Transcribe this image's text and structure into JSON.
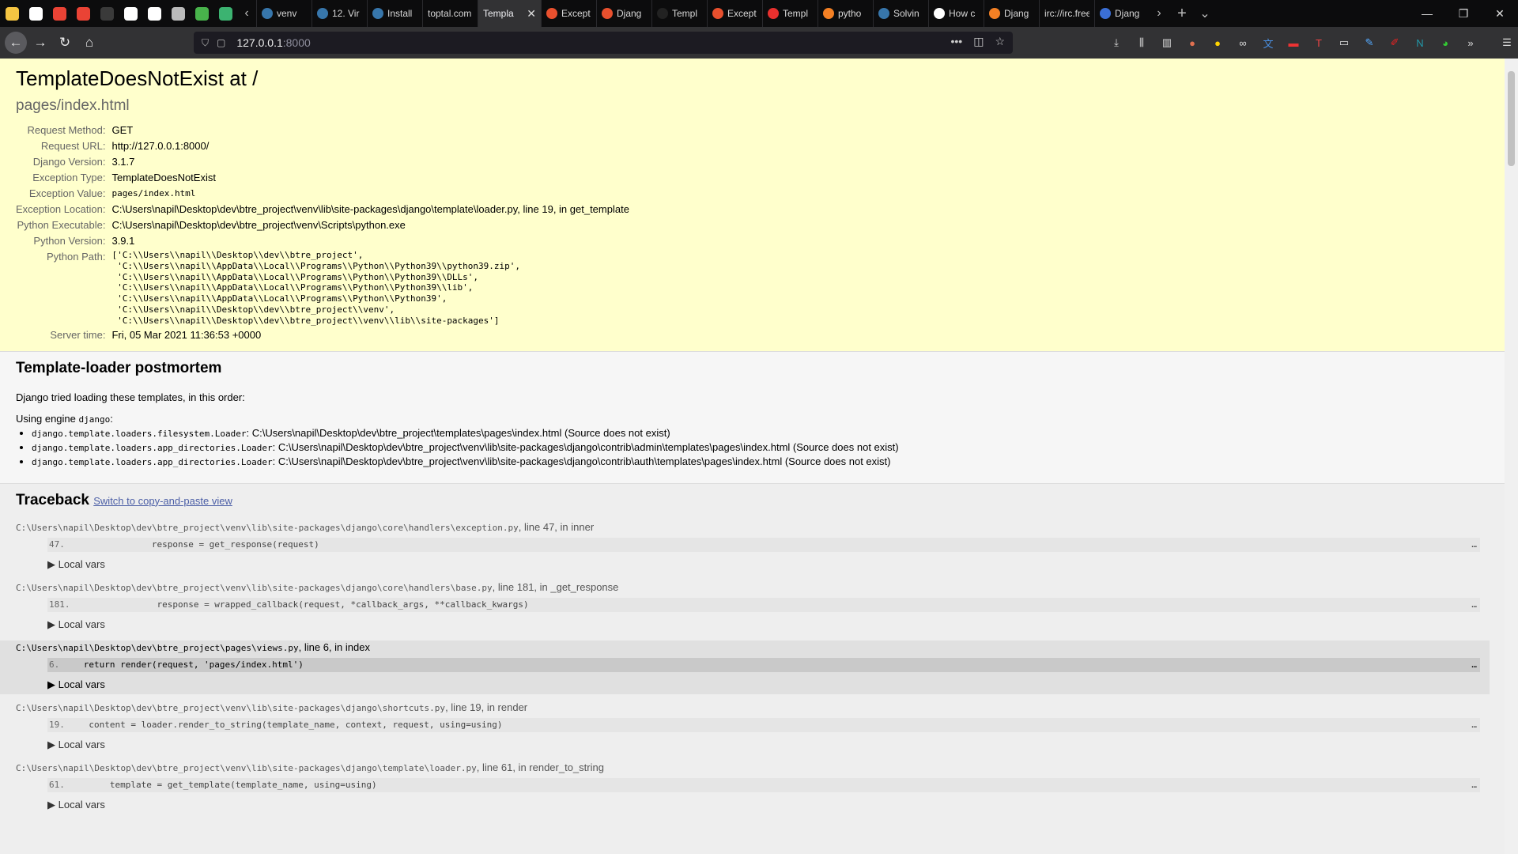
{
  "browser": {
    "pinned": [
      {
        "icon": "sticky-note-icon",
        "color": "#f5c542"
      },
      {
        "icon": "github-icon",
        "color": "#ffffff"
      },
      {
        "icon": "gmail-icon",
        "color": "#ea4335"
      },
      {
        "icon": "gmail-icon-2",
        "color": "#ea4335"
      },
      {
        "icon": "blank-icon",
        "color": "#3a3a3a"
      },
      {
        "icon": "globe-icon",
        "color": "#ffffff"
      },
      {
        "icon": "app-icon",
        "color": "#ffffff"
      },
      {
        "icon": "list-icon",
        "color": "#bbbbbb"
      },
      {
        "icon": "circle-app-icon",
        "color": "#48b34b"
      },
      {
        "icon": "note-icon",
        "color": "#3cb371"
      }
    ],
    "tabs": [
      {
        "title": "venv",
        "color": "#3776ab"
      },
      {
        "title": "12. Vir",
        "color": "#3776ab"
      },
      {
        "title": "Install",
        "color": "#3776ab"
      },
      {
        "title": "toptal.com",
        "color": ""
      },
      {
        "title": "Templa",
        "color": "",
        "active": true
      },
      {
        "title": "Except",
        "color": "#e8502e"
      },
      {
        "title": "Djang",
        "color": "#e8502e"
      },
      {
        "title": "Templ",
        "color": "#222222"
      },
      {
        "title": "Except",
        "color": "#e8502e"
      },
      {
        "title": "Templ",
        "color": "#e8302e"
      },
      {
        "title": "pytho",
        "color": "#f48024"
      },
      {
        "title": "Solvin",
        "color": "#3776ab"
      },
      {
        "title": "How c",
        "color": "#ffffff"
      },
      {
        "title": "Djang",
        "color": "#f48024"
      },
      {
        "title": "irc://irc.freen",
        "color": ""
      },
      {
        "title": "Djang",
        "color": "#3b6fd6"
      }
    ],
    "url_host": "127.0.0.1",
    "url_port": ":8000"
  },
  "summary": {
    "title": "TemplateDoesNotExist at /",
    "subtitle": "pages/index.html",
    "rows": [
      {
        "label": "Request Method:",
        "value": "GET"
      },
      {
        "label": "Request URL:",
        "value": "http://127.0.0.1:8000/"
      },
      {
        "label": "Django Version:",
        "value": "3.1.7"
      },
      {
        "label": "Exception Type:",
        "value": "TemplateDoesNotExist"
      },
      {
        "label": "Exception Value:",
        "value": "pages/index.html",
        "mono": true
      },
      {
        "label": "Exception Location:",
        "value": "C:\\Users\\napil\\Desktop\\dev\\btre_project\\venv\\lib\\site-packages\\django\\template\\loader.py, line 19, in get_template"
      },
      {
        "label": "Python Executable:",
        "value": "C:\\Users\\napil\\Desktop\\dev\\btre_project\\venv\\Scripts\\python.exe"
      },
      {
        "label": "Python Version:",
        "value": "3.9.1"
      }
    ],
    "python_path_label": "Python Path:",
    "python_path": "['C:\\\\Users\\\\napil\\\\Desktop\\\\dev\\\\btre_project',\n 'C:\\\\Users\\\\napil\\\\AppData\\\\Local\\\\Programs\\\\Python\\\\Python39\\\\python39.zip',\n 'C:\\\\Users\\\\napil\\\\AppData\\\\Local\\\\Programs\\\\Python\\\\Python39\\\\DLLs',\n 'C:\\\\Users\\\\napil\\\\AppData\\\\Local\\\\Programs\\\\Python\\\\Python39\\\\lib',\n 'C:\\\\Users\\\\napil\\\\AppData\\\\Local\\\\Programs\\\\Python\\\\Python39',\n 'C:\\\\Users\\\\napil\\\\Desktop\\\\dev\\\\btre_project\\\\venv',\n 'C:\\\\Users\\\\napil\\\\Desktop\\\\dev\\\\btre_project\\\\venv\\\\lib\\\\site-packages']",
    "server_time_label": "Server time:",
    "server_time": "Fri, 05 Mar 2021 11:36:53 +0000"
  },
  "postmortem": {
    "title": "Template-loader postmortem",
    "intro": "Django tried loading these templates, in this order:",
    "engine_prefix": "Using engine ",
    "engine_name": "django",
    "engine_suffix": ":",
    "items": [
      {
        "loader": "django.template.loaders.filesystem.Loader",
        "path": ": C:\\Users\\napil\\Desktop\\dev\\btre_project\\templates\\pages\\index.html (Source does not exist)"
      },
      {
        "loader": "django.template.loaders.app_directories.Loader",
        "path": ": C:\\Users\\napil\\Desktop\\dev\\btre_project\\venv\\lib\\site-packages\\django\\contrib\\admin\\templates\\pages\\index.html (Source does not exist)"
      },
      {
        "loader": "django.template.loaders.app_directories.Loader",
        "path": ": C:\\Users\\napil\\Desktop\\dev\\btre_project\\venv\\lib\\site-packages\\django\\contrib\\auth\\templates\\pages\\index.html (Source does not exist)"
      }
    ]
  },
  "traceback": {
    "title": "Traceback",
    "switch_link": "Switch to copy-and-paste view",
    "local_vars": "▶ Local vars",
    "frames": [
      {
        "file": "C:\\Users\\napil\\Desktop\\dev\\btre_project\\venv\\lib\\site-packages\\django\\core\\handlers\\exception.py",
        "loc": ", line 47, in inner",
        "lineno": "47.",
        "code": "                response = get_response(request)",
        "user": false
      },
      {
        "file": "C:\\Users\\napil\\Desktop\\dev\\btre_project\\venv\\lib\\site-packages\\django\\core\\handlers\\base.py",
        "loc": ", line 181, in _get_response",
        "lineno": "181.",
        "code": "                response = wrapped_callback(request, *callback_args, **callback_kwargs)",
        "user": false
      },
      {
        "file": "C:\\Users\\napil\\Desktop\\dev\\btre_project\\pages\\views.py",
        "loc": ", line 6, in index",
        "lineno": "6.",
        "code": "    return render(request, 'pages/index.html')",
        "user": true
      },
      {
        "file": "C:\\Users\\napil\\Desktop\\dev\\btre_project\\venv\\lib\\site-packages\\django\\shortcuts.py",
        "loc": ", line 19, in render",
        "lineno": "19.",
        "code": "    content = loader.render_to_string(template_name, context, request, using=using)",
        "user": false
      },
      {
        "file": "C:\\Users\\napil\\Desktop\\dev\\btre_project\\venv\\lib\\site-packages\\django\\template\\loader.py",
        "loc": ", line 61, in render_to_string",
        "lineno": "61.",
        "code": "        template = get_template(template_name, using=using)",
        "user": false
      }
    ],
    "code_ellipsis": "…"
  }
}
